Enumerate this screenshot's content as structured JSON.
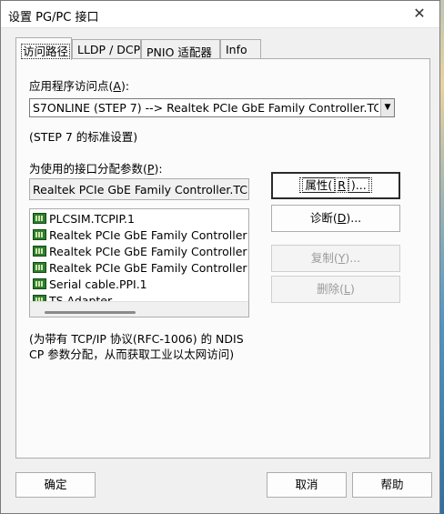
{
  "window": {
    "title": "设置 PG/PC 接口",
    "close_glyph": "✕"
  },
  "tabs": [
    {
      "label": "访问路径"
    },
    {
      "label": "LLDP / DCP"
    },
    {
      "label": "PNIO 适配器"
    },
    {
      "label": "Info"
    }
  ],
  "access_point": {
    "label_prefix": "应用程序访问点(",
    "label_key": "A",
    "label_suffix": "):",
    "value": "S7ONLINE (STEP 7)       --> Realtek PCIe GbE Family Controller.TC",
    "dropdown_glyph": "▼"
  },
  "standard_note": "(STEP 7 的标准设置)",
  "params": {
    "label_prefix": "为使用的接口分配参数(",
    "label_key": "P",
    "label_suffix": "):",
    "current": "Realtek PCIe GbE Family Controller.TCPIP"
  },
  "interfaces": [
    "PLCSIM.TCPIP.1",
    "Realtek PCIe GbE Family Controller",
    "Realtek PCIe GbE Family Controller",
    "Realtek PCIe GbE Family Controller",
    "Serial cable.PPI.1",
    "TS Adapter"
  ],
  "buttons": {
    "properties": {
      "prefix": "属性(",
      "key": "R",
      "suffix": ")..."
    },
    "diagnostics": {
      "prefix": "诊断(",
      "key": "D",
      "suffix": ")..."
    },
    "copy": {
      "prefix": "复制(",
      "key": "Y",
      "suffix": ")..."
    },
    "delete": {
      "prefix": "删除(",
      "key": "L",
      "suffix": ")"
    }
  },
  "info_line1": "(为带有 TCP/IP 协议(RFC-1006) 的 NDIS",
  "info_line2": "CP 参数分配，从而获取工业以太网访问)",
  "footer": {
    "ok": "确定",
    "cancel": "取消",
    "help": "帮助"
  }
}
